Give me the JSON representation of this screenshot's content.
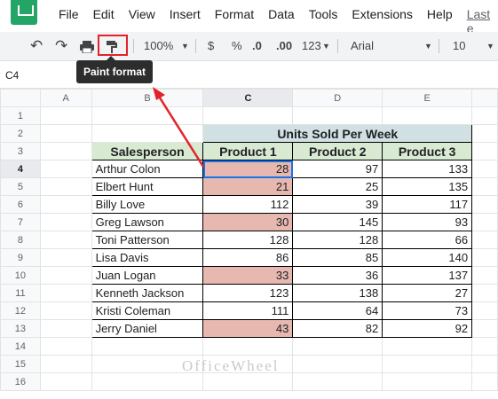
{
  "menu": {
    "items": [
      "File",
      "Edit",
      "View",
      "Insert",
      "Format",
      "Data",
      "Tools",
      "Extensions",
      "Help"
    ],
    "last_edit": "Last e"
  },
  "toolbar": {
    "zoom": "100%",
    "currency": "$",
    "percent": "%",
    "dec_decrease": ".0",
    "dec_increase": ".00",
    "format_more": "123",
    "font": "Arial",
    "font_size": "10"
  },
  "tooltip": "Paint format",
  "name_box": "C4",
  "columns": [
    "A",
    "B",
    "C",
    "D",
    "E"
  ],
  "rows": [
    "1",
    "2",
    "3",
    "4",
    "5",
    "6",
    "7",
    "8",
    "9",
    "10",
    "11",
    "12",
    "13",
    "14",
    "15",
    "16"
  ],
  "table": {
    "group_header": "Units Sold Per Week",
    "headers": [
      "Salesperson",
      "Product 1",
      "Product 2",
      "Product 3"
    ],
    "data": [
      [
        "Arthur Colon",
        "28",
        "97",
        "133"
      ],
      [
        "Elbert Hunt",
        "21",
        "25",
        "135"
      ],
      [
        "Billy Love",
        "112",
        "39",
        "117"
      ],
      [
        "Greg Lawson",
        "30",
        "145",
        "93"
      ],
      [
        "Toni Patterson",
        "128",
        "128",
        "66"
      ],
      [
        "Lisa Davis",
        "86",
        "85",
        "140"
      ],
      [
        "Juan Logan",
        "33",
        "36",
        "137"
      ],
      [
        "Kenneth Jackson",
        "123",
        "138",
        "27"
      ],
      [
        "Kristi Coleman",
        "111",
        "64",
        "73"
      ],
      [
        "Jerry Daniel",
        "43",
        "82",
        "92"
      ]
    ],
    "highlighted_rows": [
      0,
      1,
      3,
      6,
      9
    ]
  },
  "colors": {
    "highlight": "#e6b8af",
    "header_green": "#d9ead3",
    "header_teal": "#d0e0e3",
    "annotation": "#e3232c"
  },
  "watermark": "OfficeWheel"
}
